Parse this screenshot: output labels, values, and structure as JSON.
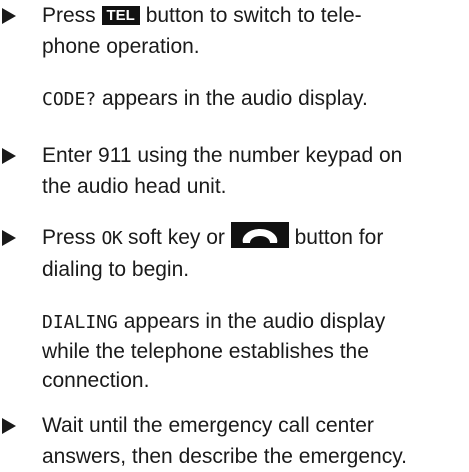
{
  "steps": [
    {
      "before_key": "Press ",
      "key_label": "TEL",
      "after_key_line1": " button to switch to tele-",
      "line2": "phone operation."
    },
    {
      "line1": "Enter 911 using the number keypad on",
      "line2": "the audio head unit."
    },
    {
      "before_softkey": "Press ",
      "softkey": "OK",
      "after_softkey": " soft key or ",
      "after_icon": " button for",
      "line2": "dialing to begin."
    },
    {
      "line1": "Wait until the emergency call center",
      "line2": "answers, then describe the emergency."
    }
  ],
  "notes": [
    {
      "code": "CODE?",
      "rest": " appears in the audio display."
    },
    {
      "code": "DIALING",
      "rest_line1": " appears in the audio display",
      "line2": "while the telephone establishes the",
      "line3": "connection."
    }
  ],
  "icons": {
    "bullet": "triangle-right-icon",
    "phone_key": "telephone-handset-icon"
  },
  "colors": {
    "text": "#1a1a1a",
    "key_background": "#111111",
    "key_text": "#ffffff"
  }
}
